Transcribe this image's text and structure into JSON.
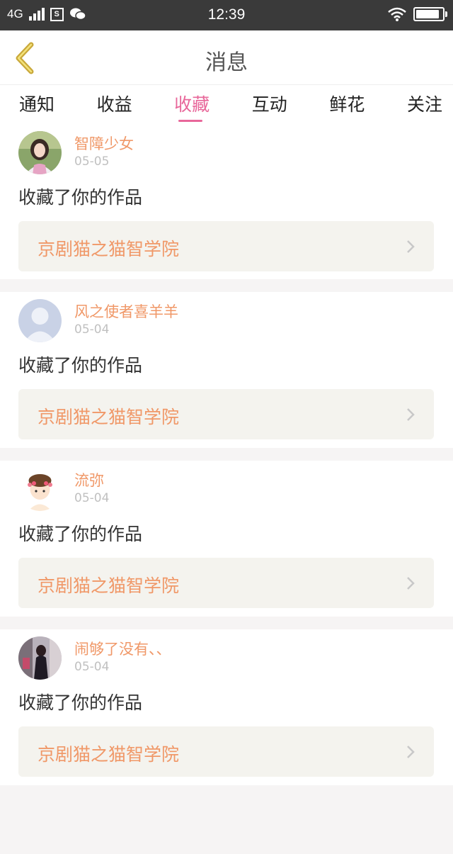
{
  "status_bar": {
    "network": "4G",
    "sim_label": "S",
    "time": "12:39",
    "battery_level": 0.9
  },
  "header": {
    "title": "消息"
  },
  "tabs": [
    {
      "label": "通知",
      "active": false
    },
    {
      "label": "收益",
      "active": false
    },
    {
      "label": "收藏",
      "active": true
    },
    {
      "label": "互动",
      "active": false
    },
    {
      "label": "鲜花",
      "active": false
    },
    {
      "label": "关注",
      "active": false
    }
  ],
  "items": [
    {
      "username": "智障少女",
      "date": "05-05",
      "message": "收藏了你的作品",
      "work_title": "京剧猫之猫智学院",
      "avatar": "girl-photo-avatar"
    },
    {
      "username": "风之使者喜羊羊",
      "date": "05-04",
      "message": "收藏了你的作品",
      "work_title": "京剧猫之猫智学院",
      "avatar": "default-avatar"
    },
    {
      "username": "流弥",
      "date": "05-04",
      "message": "收藏了你的作品",
      "work_title": "京剧猫之猫智学院",
      "avatar": "cartoon-girl-avatar"
    },
    {
      "username": "闹够了没有、、",
      "date": "05-04",
      "message": "收藏了你的作品",
      "work_title": "京剧猫之猫智学院",
      "avatar": "photo-avatar"
    }
  ],
  "colors": {
    "accent": "#e8679a",
    "name": "#f09868",
    "back_icon": "#c9a83a",
    "status_bar": "#3a3a3a"
  }
}
